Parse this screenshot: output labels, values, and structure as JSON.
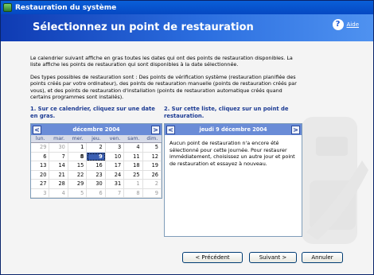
{
  "window": {
    "title": "Restauration du système"
  },
  "header": {
    "title": "Sélectionnez un point de restauration",
    "help_label": "Aide"
  },
  "intro": {
    "p1": "Le calendrier suivant affiche en gras toutes les dates qui ont des points de restauration disponibles. La liste affiche les points de restauration qui sont disponibles à la date sélectionnée.",
    "p2": "Des types possibles de restauration sont : Des points de vérification système (restauration planifiée des points créés par votre ordinateur), des points de restauration manuelle (points de restauration créés par vous), et des points de restauration d'installation (points de restauration automatique créés quand certains programmes sont installés)."
  },
  "step1": {
    "label": "1. Sur ce calendrier, cliquez sur une date en gras."
  },
  "step2": {
    "label": "2. Sur cette liste, cliquez sur un point de restauration."
  },
  "calendar": {
    "month": "décembre 2004",
    "prev": "<",
    "next": ">",
    "days": [
      "lun.",
      "mar.",
      "mer.",
      "jeu.",
      "ven.",
      "sam.",
      "dim."
    ],
    "weeks": [
      [
        [
          "29",
          "other"
        ],
        [
          "30",
          "other"
        ],
        [
          "1",
          ""
        ],
        [
          "2",
          ""
        ],
        [
          "3",
          ""
        ],
        [
          "4",
          ""
        ],
        [
          "5",
          ""
        ]
      ],
      [
        [
          "6",
          ""
        ],
        [
          "7",
          ""
        ],
        [
          "8",
          "bold"
        ],
        [
          "9",
          "sel"
        ],
        [
          "10",
          ""
        ],
        [
          "11",
          ""
        ],
        [
          "12",
          ""
        ]
      ],
      [
        [
          "13",
          ""
        ],
        [
          "14",
          ""
        ],
        [
          "15",
          ""
        ],
        [
          "16",
          ""
        ],
        [
          "17",
          ""
        ],
        [
          "18",
          ""
        ],
        [
          "19",
          ""
        ]
      ],
      [
        [
          "20",
          ""
        ],
        [
          "21",
          ""
        ],
        [
          "22",
          ""
        ],
        [
          "23",
          ""
        ],
        [
          "24",
          ""
        ],
        [
          "25",
          ""
        ],
        [
          "26",
          ""
        ]
      ],
      [
        [
          "27",
          ""
        ],
        [
          "28",
          ""
        ],
        [
          "29",
          ""
        ],
        [
          "30",
          ""
        ],
        [
          "31",
          ""
        ],
        [
          "1",
          "other"
        ],
        [
          "2",
          "other"
        ]
      ],
      [
        [
          "3",
          "other"
        ],
        [
          "4",
          "other"
        ],
        [
          "5",
          "other"
        ],
        [
          "6",
          "other"
        ],
        [
          "7",
          "other"
        ],
        [
          "8",
          "other"
        ],
        [
          "9",
          "other"
        ]
      ]
    ]
  },
  "list": {
    "header": "jeudi 9 décembre 2004",
    "prev": "<",
    "next": ">",
    "message": "Aucun point de restauration n'a encore été sélectionné pour cette journée. Pour restaurer immédiatement, choisissez un autre jour et point de restauration et essayez à nouveau."
  },
  "buttons": {
    "back": "< Précédent",
    "next": "Suivant >",
    "cancel": "Annuler"
  }
}
